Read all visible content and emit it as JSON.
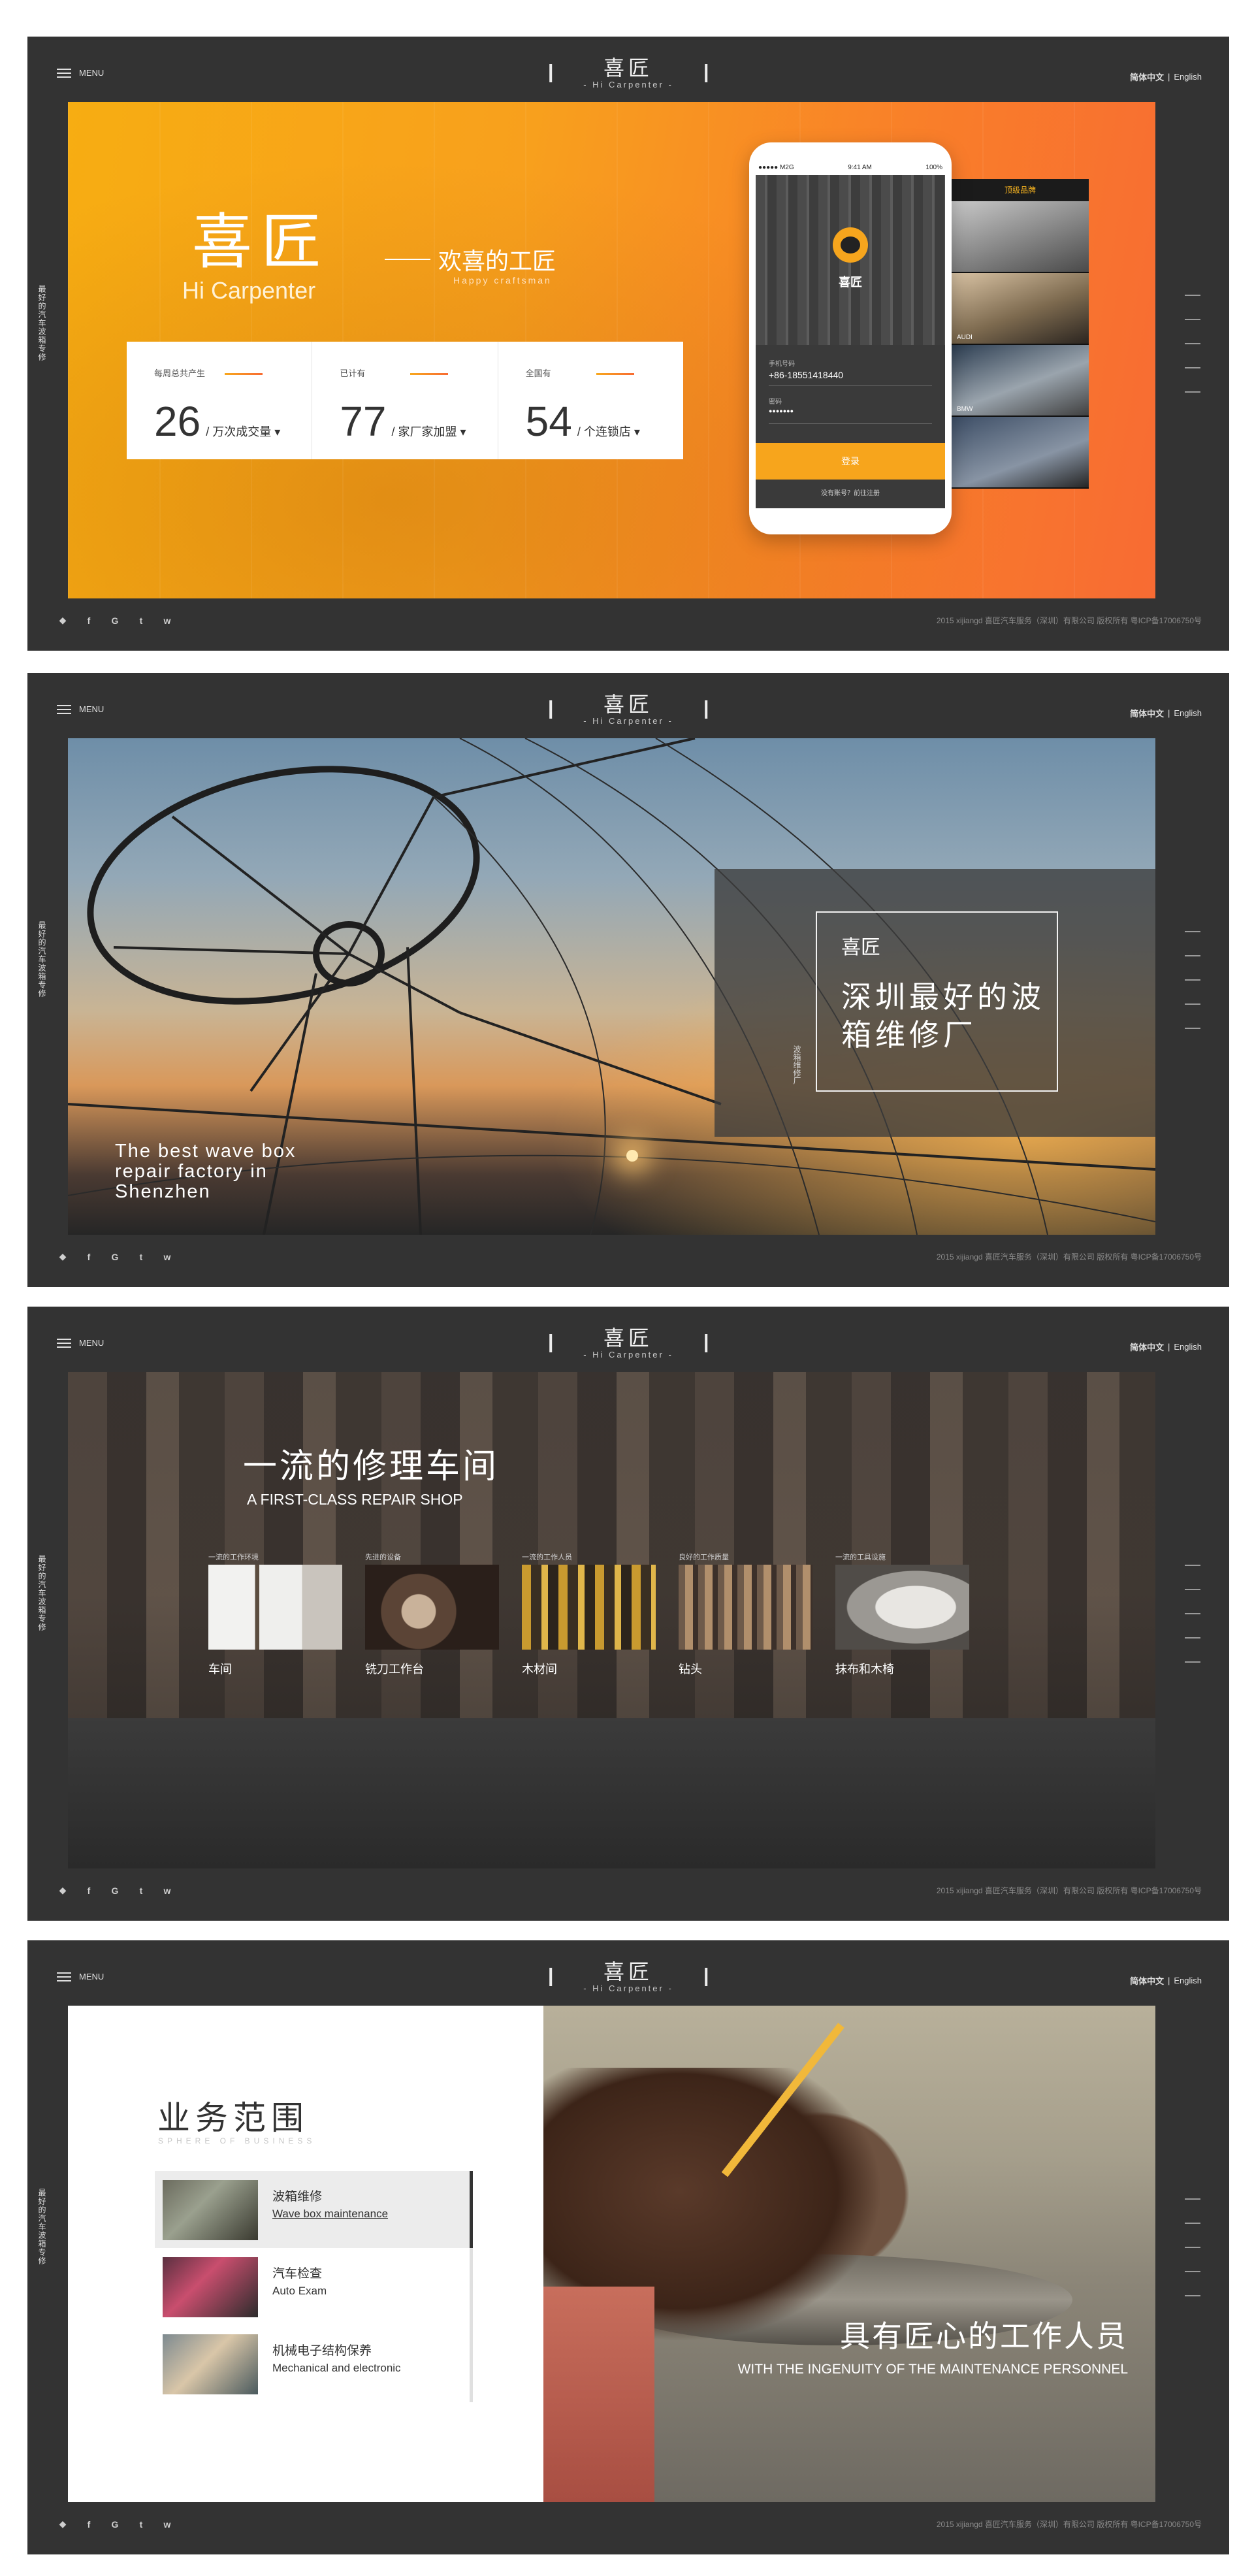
{
  "chrome": {
    "menu_label": "MENU",
    "logo_cn": "喜匠",
    "logo_en": "- Hi Carpenter -",
    "lang_cn": "简体中文",
    "lang_sep": "|",
    "lang_en": "English",
    "side_text": "最好的汽车波箱专修",
    "social_icons": [
      "qq-icon",
      "facebook-icon",
      "google-icon",
      "twitter-icon",
      "weibo-icon"
    ],
    "social_glyphs": [
      "◆",
      "f",
      "G",
      "t",
      "w"
    ],
    "copyright": "2015 xijiangd 喜匠汽车服务（深圳）有限公司 版权所有 粤ICP备17006750号"
  },
  "slide1": {
    "hero_cn": "喜匠",
    "hero_en": "Hi Carpenter",
    "tagline": "欢喜的工匠",
    "tagline_en": "Happy craftsman",
    "stats": [
      {
        "label": "每周总共产生",
        "value": "26",
        "unit": "万次成交量"
      },
      {
        "label": "已计有",
        "value": "77",
        "unit": "家厂家加盟"
      },
      {
        "label": "全国有",
        "value": "54",
        "unit": "个连锁店"
      }
    ],
    "phone": {
      "carrier": "●●●●● M2G",
      "time": "9:41 AM",
      "battery": "100%",
      "app_name": "喜匠",
      "phone_label": "手机号码",
      "phone_value": "+86-18551418440",
      "password_label": "密码",
      "password_value": "●●●●●●●",
      "login_label": "登录",
      "register_label": "没有账号？前往注册"
    },
    "phone2": {
      "header": "顶级品牌",
      "cars": [
        {
          "brand": "",
          "model": ""
        },
        {
          "brand": "AUDI",
          "model": ""
        },
        {
          "brand": "BMW",
          "model": ""
        },
        {
          "brand": "",
          "model": ""
        }
      ]
    }
  },
  "slide2": {
    "caption_en": "The best wave box repair factory in Shenzhen",
    "box_small": "喜匠",
    "box_big": "深圳最好的波箱维修厂",
    "box_vertical": "波箱维修厂"
  },
  "slide3": {
    "title": "一流的修理车间",
    "subtitle": "A FIRST-CLASS REPAIR SHOP",
    "categories": [
      {
        "small": "一流的工作环境",
        "name": "车间"
      },
      {
        "small": "先进的设备",
        "name": "铣刀工作台"
      },
      {
        "small": "一流的工作人员",
        "name": "木材间"
      },
      {
        "small": "良好的工作质量",
        "name": "钻头"
      },
      {
        "small": "一流的工具设施",
        "name": "抹布和木椅"
      }
    ]
  },
  "slide4": {
    "title": "业务范围",
    "subtitle": "SPHERE OF BUSINESS",
    "services": [
      {
        "cn": "波箱维修",
        "en": "Wave box maintenance",
        "active": true
      },
      {
        "cn": "汽车检查",
        "en": "Auto Exam",
        "active": false
      },
      {
        "cn": "机械电子结构保养",
        "en": "Mechanical and electronic",
        "active": false
      }
    ],
    "caption_cn": "具有匠心的工作人员",
    "caption_en": "WITH THE INGENUITY OF THE MAINTENANCE PERSONNEL"
  },
  "colors": {
    "dark_bg": "#333333",
    "accent_orange": "#f7a51c",
    "accent_red_orange": "#f86b33"
  }
}
